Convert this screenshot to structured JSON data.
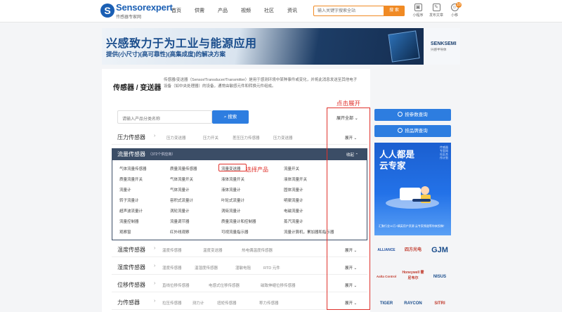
{
  "header": {
    "logo_text": "Sensorexpert",
    "logo_sub": "传感器专家网",
    "nav": [
      "首页",
      "供需",
      "产品",
      "视频",
      "社区",
      "资讯"
    ],
    "search_placeholder": "输入关键字搜索全站",
    "search_button": "搜 索",
    "icons": [
      {
        "label": "小程序",
        "icon": "mini-program-icon"
      },
      {
        "label": "发布文章",
        "icon": "publish-article-icon"
      },
      {
        "label": "小移",
        "icon": "user-icon",
        "badge": "10"
      }
    ]
  },
  "banner": {
    "title": "兴感致力于为工业与能源应用",
    "subtitle": "提供(小尺寸)(高可靠性)(高集成度)的解决方案",
    "brand": "SENKSEMI",
    "brand_sub": "兴感半导体"
  },
  "category": {
    "title": "传感器 / 变送器",
    "description": "传感器/变送器（Sensor/Transducer/Transmitter）是用于感测环境中某种事件或变化，并将此消息发送至其他电子设备（如中央处理器）的设备，通常由敏感元件和转换元件组成。"
  },
  "product_search": {
    "placeholder": "请输入产品分类名称",
    "button": "搜索",
    "expand_all": "展开全部"
  },
  "rows": [
    {
      "name": "压力传感器",
      "subs": [
        "压力变送器",
        "压力开关",
        "差压压力传感器",
        "压力变送器"
      ],
      "toggle": "展开"
    },
    {
      "name": "温度传感器",
      "subs": [
        "温度传感器",
        "温度变送器",
        "热电偶温度传感器"
      ],
      "toggle": "展开"
    },
    {
      "name": "湿度传感器",
      "subs": [
        "湿度传感器",
        "温湿度传感器",
        "湿敏电阻",
        "RTD 元件"
      ],
      "toggle": "展开"
    },
    {
      "name": "位移传感器",
      "subs": [
        "直线位移传感器",
        "电感式位移传感器",
        "磁致伸缩位移传感器"
      ],
      "toggle": "展开"
    },
    {
      "name": "力传感器",
      "subs": [
        "拉压传感器",
        "测力计",
        "扭矩传感器",
        "称力传感器"
      ],
      "toggle": "展开"
    }
  ],
  "flow": {
    "name": "流量传感器",
    "count": "（372个供应商）",
    "toggle": "收起",
    "products": [
      [
        "气体流量传感器",
        "质量流量传感器",
        "流量变送器",
        "流量开关"
      ],
      [
        "质量流量开关",
        "气体流量开关",
        "液体流量开关",
        "液体流量开关"
      ],
      [
        "流量计",
        "气体流量计",
        "液体流量计",
        "固体流量计"
      ],
      [
        "转子流量计",
        "容积式流量计",
        "叶轮式流量计",
        "明渠流量计"
      ],
      [
        "超声波流量计",
        "涡轮流量计",
        "涡街流量计",
        "电磁流量计"
      ],
      [
        "流量控制器",
        "流量调节器",
        "质量流量计和控制器",
        "蒸汽流量计"
      ],
      [
        "观察窗",
        "红外线观察",
        "可视流量指示器",
        "流量计算机，累加器和指示器"
      ]
    ]
  },
  "annotations": {
    "expand": "点击展开",
    "select": "选择产品"
  },
  "sidebar": {
    "btn1": "按参数查询",
    "btn2": "按品牌查询",
    "ad_title1": "人人都是",
    "ad_title2": "云专家",
    "ad_side": "传感器专家网社区合作计划",
    "ad_foot": "汇聚行业10万+精英用户资源 云专家频道等你来投稿！",
    "logos": [
      "ALLIANCE",
      "四方光电",
      "GJM",
      "Aalta Control",
      "Honeywell 霍尼韦尔",
      "NISUS",
      "TIGER",
      "RAYCON",
      "SITRI"
    ]
  },
  "colors": {
    "accent_orange": "#f08a24",
    "primary_blue": "#2d7de0",
    "header_dark": "#3b4d66",
    "annotation_red": "#e0322c"
  }
}
